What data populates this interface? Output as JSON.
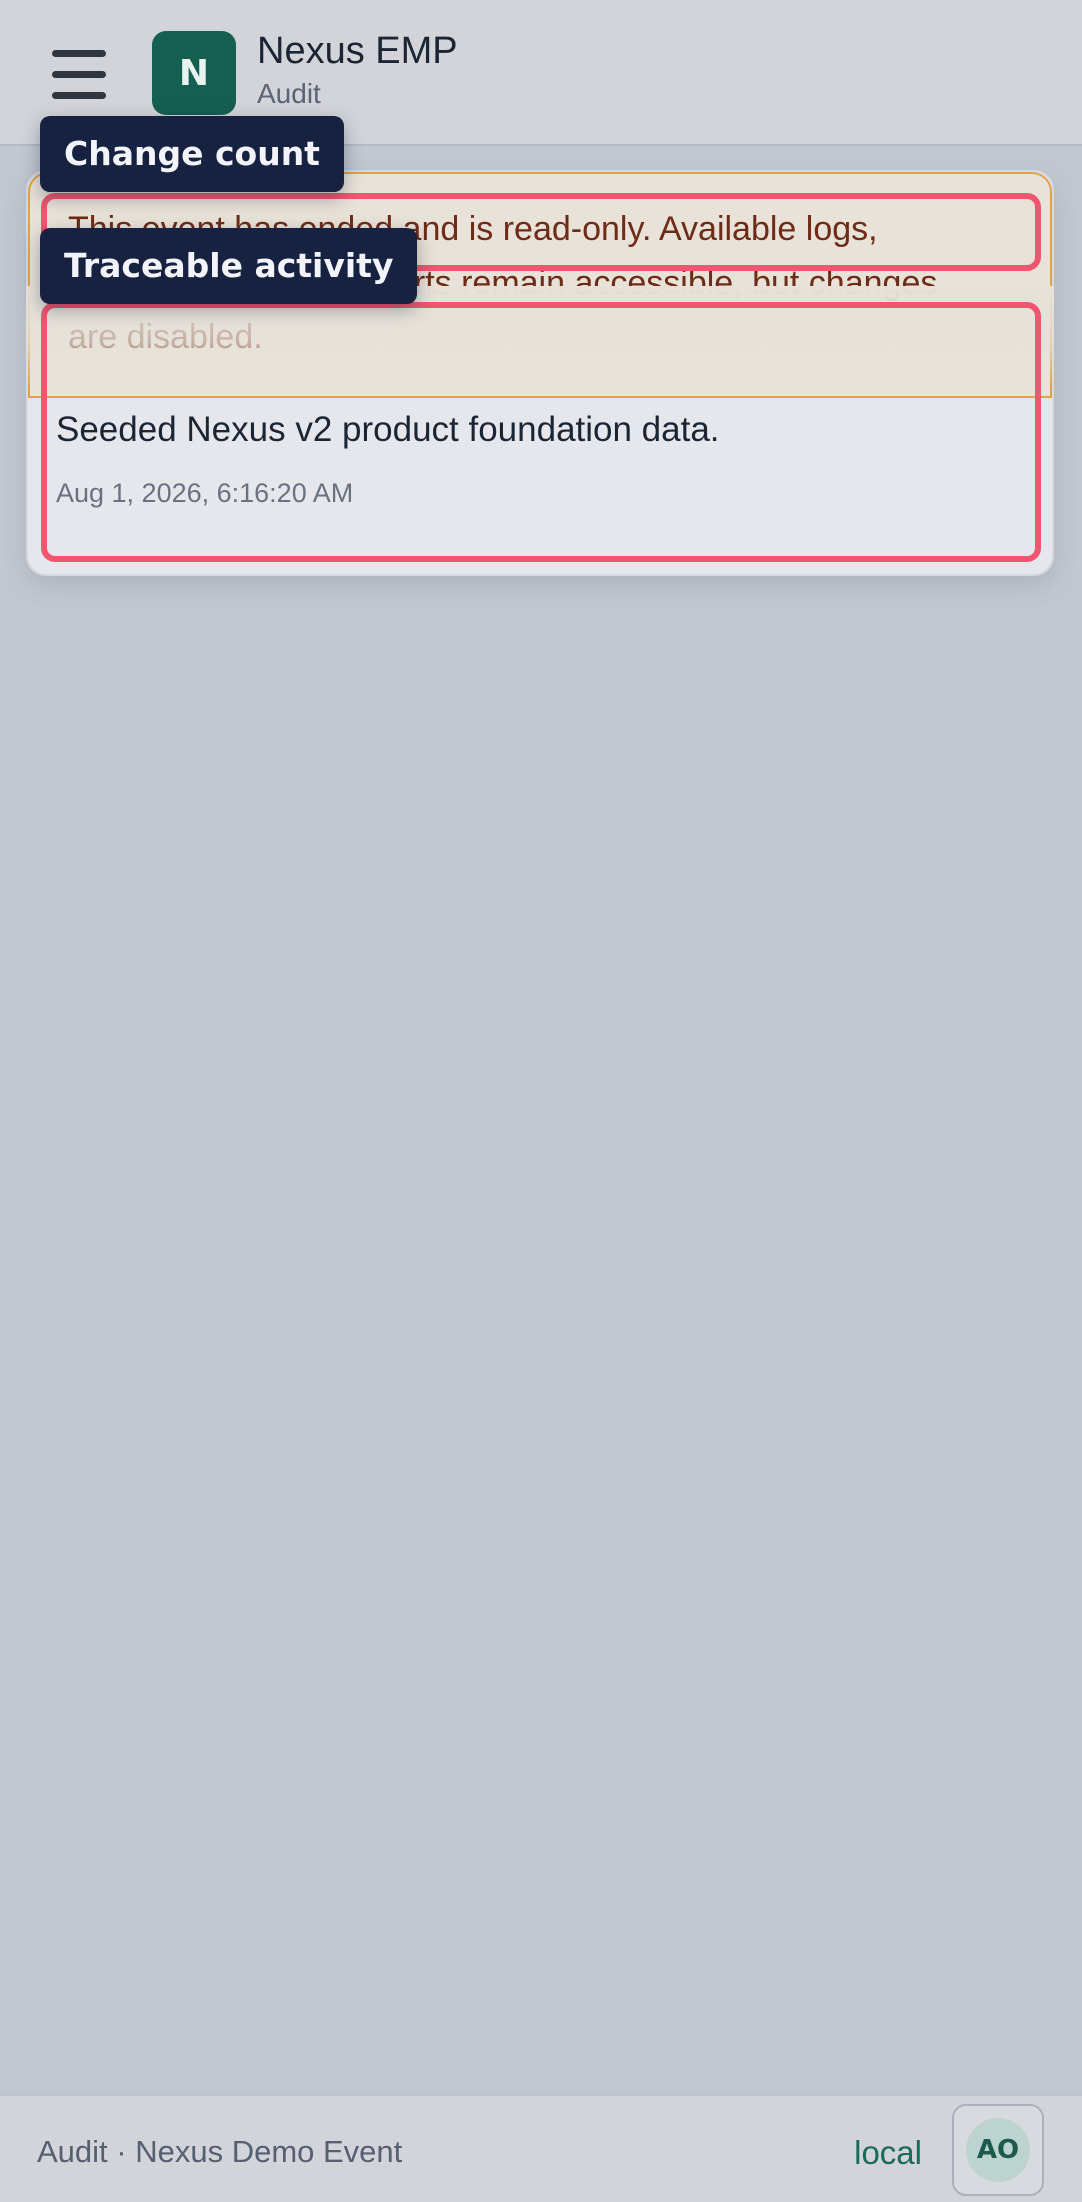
{
  "header": {
    "logo_letter": "N",
    "app_title": "Nexus EMP",
    "section": "Audit"
  },
  "notice": {
    "text": "This event has ended and is read-only. Available logs, search, print, and exports remain accessible, but changes are disabled.",
    "colors": {
      "background": "#e8e2d8",
      "border": "#dda44a",
      "text": "#6e2b17"
    }
  },
  "audit_log": {
    "entries": [
      {
        "message": "Seeded Nexus v2 product foundation data.",
        "timestamp": "Aug 1, 2026, 6:16:20 AM"
      }
    ]
  },
  "tooltips": {
    "change_count": "Change count",
    "traceable_activity": "Traceable activity"
  },
  "footer": {
    "context": "Audit · Nexus Demo Event",
    "environment": "local",
    "avatar_initials": "AO"
  },
  "colors": {
    "brand": "#155f50",
    "highlight": "#f0566f",
    "tooltip_bg": "#162240"
  },
  "icons": {
    "menu": "hamburger-menu-icon"
  }
}
